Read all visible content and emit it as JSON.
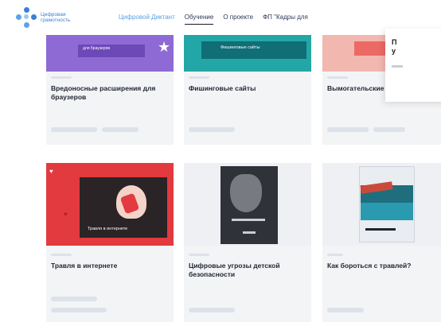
{
  "header": {
    "logo_line1": "Цифровая",
    "logo_line2": "грамотность",
    "nav": [
      {
        "label": "Цифровой Диктант",
        "active": false,
        "brand": true
      },
      {
        "label": "Обучение",
        "active": true,
        "brand": false
      },
      {
        "label": "О проекте",
        "active": false,
        "brand": false
      },
      {
        "label": "ФП \"Кадры для",
        "active": false,
        "brand": false
      }
    ]
  },
  "popup": {
    "line1": "П",
    "line2": "у"
  },
  "cards_top": [
    {
      "image_caption": "для браузеров",
      "title": "Вредоносные расширения для браузеров"
    },
    {
      "image_caption": "Фишинговые сайты",
      "title": "Фишинговые сайты"
    },
    {
      "image_caption": "",
      "title": "Вымогательские троянцы"
    }
  ],
  "cards_bottom": [
    {
      "image_caption": "Травля в интернете",
      "title": "Травля в интернете"
    },
    {
      "image_caption": "",
      "title": "Цифровые угрозы детской безопасности"
    },
    {
      "image_caption": "",
      "title": "Как бороться с травлей?"
    }
  ],
  "colors": {
    "accent": "#3b7fd6",
    "card_bg": "#f3f4f6",
    "purple": "#8e6ad4",
    "teal": "#23a7a6",
    "pink": "#f2b8b0",
    "red": "#e23a3e"
  }
}
